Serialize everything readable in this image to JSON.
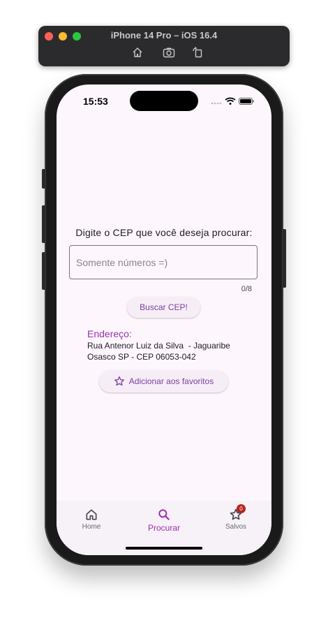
{
  "simulator": {
    "title": "iPhone 14 Pro – iOS 16.4",
    "tools": [
      "home-icon",
      "screenshot-icon",
      "rotate-icon"
    ]
  },
  "status_bar": {
    "time": "15:53"
  },
  "search": {
    "prompt": "Digite o CEP que você deseja procurar:",
    "placeholder": "Somente números =)",
    "value": "",
    "counter": "0/8",
    "button_label": "Buscar CEP!"
  },
  "address": {
    "title": "Endereço:",
    "line1": "Rua Antenor Luiz da Silva  - Jaguaribe",
    "line2": "Osasco SP - CEP 06053-042"
  },
  "favorite_button": {
    "label": "Adicionar aos favoritos",
    "icon": "star-outline-icon"
  },
  "bottom_nav": {
    "items": [
      {
        "label": "Home",
        "icon": "home-icon",
        "active": false
      },
      {
        "label": "Procurar",
        "icon": "search-icon",
        "active": true
      },
      {
        "label": "Salvos",
        "icon": "star-outline-icon",
        "active": false,
        "badge": "0"
      }
    ]
  },
  "colors": {
    "accent": "#9b2fae",
    "background": "#fdf7fd",
    "badge": "#b3261e"
  }
}
